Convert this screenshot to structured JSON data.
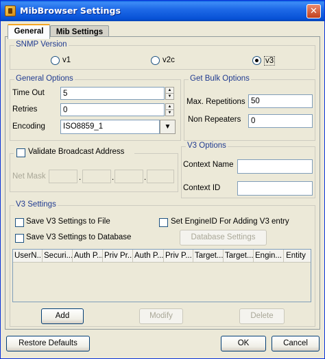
{
  "window": {
    "title": "MibBrowser Settings",
    "close_glyph": "✕"
  },
  "tabs": [
    {
      "label": "General",
      "active": true
    },
    {
      "label": "Mib Settings",
      "active": false
    }
  ],
  "snmp_version": {
    "title": "SNMP Version",
    "options": [
      {
        "label": "v1",
        "selected": false
      },
      {
        "label": "v2c",
        "selected": false
      },
      {
        "label": "v3",
        "selected": true
      }
    ]
  },
  "general_options": {
    "title": "General Options",
    "timeout": {
      "label": "Time Out",
      "value": "5"
    },
    "retries": {
      "label": "Retries",
      "value": "0"
    },
    "encoding": {
      "label": "Encoding",
      "value": "ISO8859_1"
    }
  },
  "get_bulk": {
    "title": "Get Bulk Options",
    "max_repetitions": {
      "label": "Max. Repetitions",
      "value": "50"
    },
    "non_repeaters": {
      "label": "Non Repeaters",
      "value": "0"
    }
  },
  "broadcast": {
    "label": "Validate Broadcast Address",
    "checked": false,
    "net_mask_label": "Net Mask",
    "octets": [
      "",
      "",
      "",
      ""
    ],
    "separator": "."
  },
  "v3_options": {
    "title": "V3 Options",
    "context_name": {
      "label": "Context Name",
      "value": ""
    },
    "context_id": {
      "label": "Context ID",
      "value": ""
    }
  },
  "v3_settings": {
    "title": "V3 Settings",
    "save_to_file": {
      "label": "Save V3 Settings to File",
      "checked": false
    },
    "set_engine_id": {
      "label": "Set EngineID For Adding V3 entry",
      "checked": false
    },
    "save_to_db": {
      "label": "Save V3 Settings to Database",
      "checked": false
    },
    "db_settings_button": "Database Settings",
    "columns": [
      "UserN...",
      "Securi...",
      "Auth P...",
      "Priv Pr...",
      "Auth P...",
      "Priv P...",
      "Target...",
      "Target...",
      "Engin...",
      "Entity"
    ],
    "add_button": "Add",
    "modify_button": "Modify",
    "delete_button": "Delete"
  },
  "footer": {
    "restore_defaults": "Restore Defaults",
    "ok": "OK",
    "cancel": "Cancel"
  },
  "colors": {
    "titlebar": "#0751d6",
    "group_title": "#1f3a90",
    "tab_highlight": "#f5a623"
  }
}
